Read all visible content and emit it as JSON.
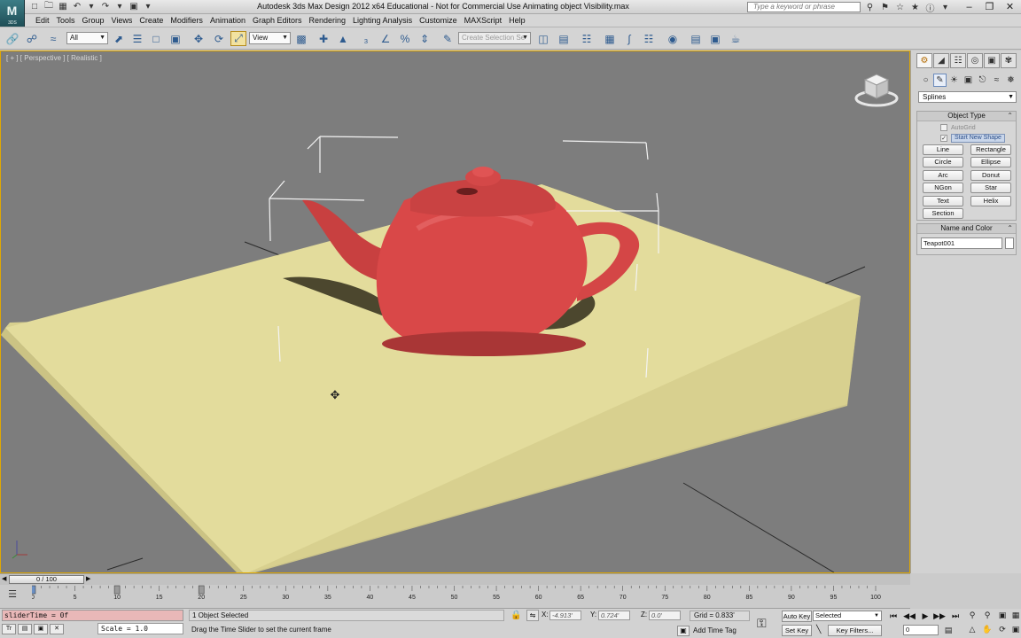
{
  "app": {
    "logo": "M",
    "logo_caption": "3DS",
    "window_title": "Autodesk 3ds Max Design 2012 x64    Educational - Not for Commercial Use    Animating object Visibility.max",
    "search_placeholder": "Type a keyword or phrase"
  },
  "menu": [
    "Edit",
    "Tools",
    "Group",
    "Views",
    "Create",
    "Modifiers",
    "Animation",
    "Graph Editors",
    "Rendering",
    "Lighting Analysis",
    "Customize",
    "MAXScript",
    "Help"
  ],
  "toolbar": {
    "selection_filter": "All",
    "reference_coord": "View",
    "named_selection_placeholder": "Create Selection Se"
  },
  "viewport": {
    "label": "[ + ] [ Perspective ] [ Realistic ]",
    "table_color": "#e3dc9c",
    "teapot_color": "#d94848",
    "background_color": "#7d7d7d"
  },
  "command_panel": {
    "category_dropdown": "Splines",
    "object_type_title": "Object Type",
    "autogrid_label": "AutoGrid",
    "start_new_shape_label": "Start New Shape",
    "buttons": [
      "Line",
      "Rectangle",
      "Circle",
      "Ellipse",
      "Arc",
      "Donut",
      "NGon",
      "Star",
      "Text",
      "Helix",
      "Section"
    ],
    "name_color_title": "Name and Color",
    "object_name": "Teapot001"
  },
  "time_slider": {
    "label": "0 / 100",
    "current_frame": 0,
    "total_frames": 100
  },
  "trackbar": {
    "ticks": [
      "0",
      "5",
      "10",
      "15",
      "20",
      "25",
      "30",
      "35",
      "40",
      "45",
      "50",
      "55",
      "60",
      "65",
      "70",
      "75",
      "80",
      "85",
      "90",
      "95",
      "100"
    ],
    "keyframes": [
      0,
      10,
      20
    ]
  },
  "status": {
    "maxscript_listener": "sliderTime = 0f",
    "maxscript_output": "Scale = 1.0",
    "selection_status": "1 Object Selected",
    "prompt": "Drag the Time Slider to set the current frame",
    "x_label": "X:",
    "x_value": "-4.913'",
    "y_label": "Y:",
    "y_value": "0.724'",
    "z_label": "Z:",
    "z_value": "0.0'",
    "grid": "Grid = 0.833'",
    "add_time_tag": "Add Time Tag",
    "auto_key": "Auto Key",
    "set_key": "Set Key",
    "key_mode": "Selected",
    "key_filters": "Key Filters...",
    "frame_value": "0"
  }
}
